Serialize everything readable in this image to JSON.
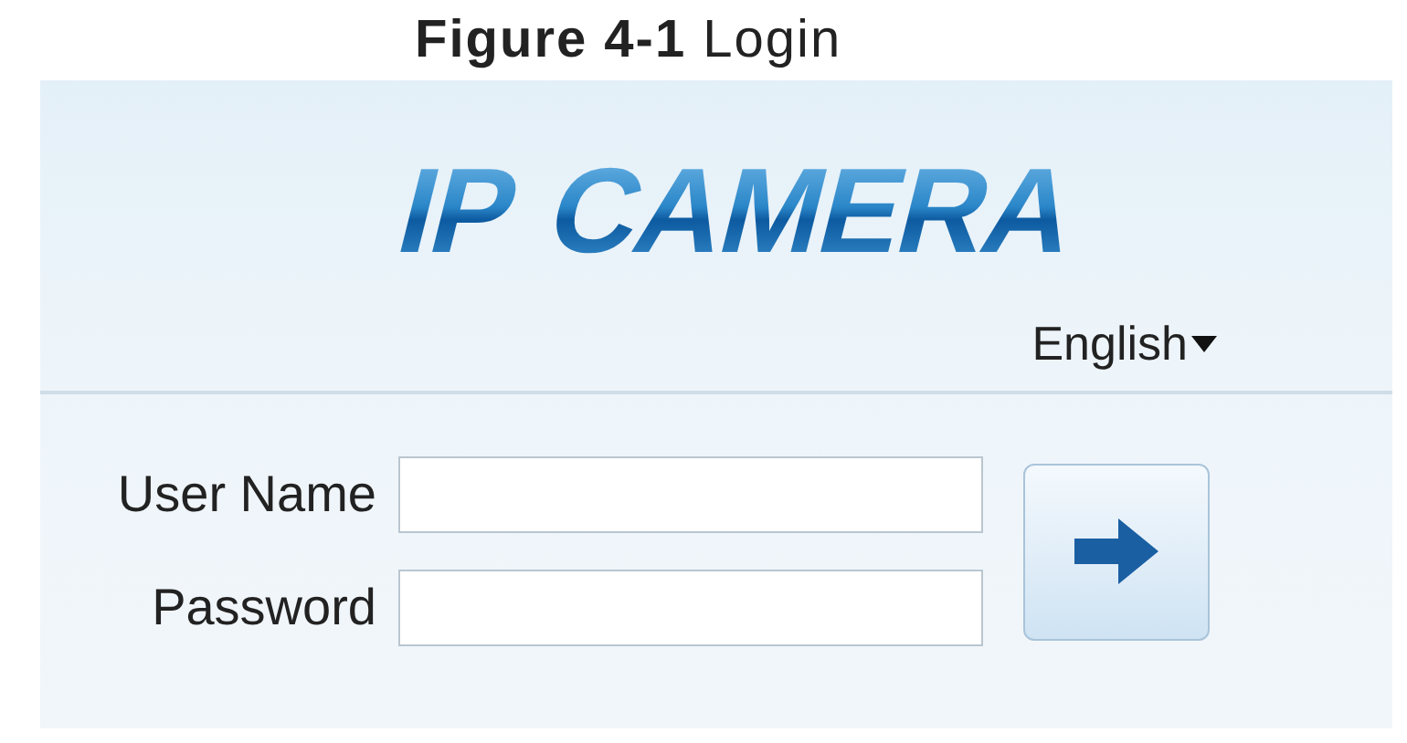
{
  "caption": "**Figure 4-1** Login",
  "logo": "IP CAMERA",
  "language": "English",
  "fields": [
    {
      "label": "User Name"
    },
    {
      "label": "Password"
    }
  ]
}
